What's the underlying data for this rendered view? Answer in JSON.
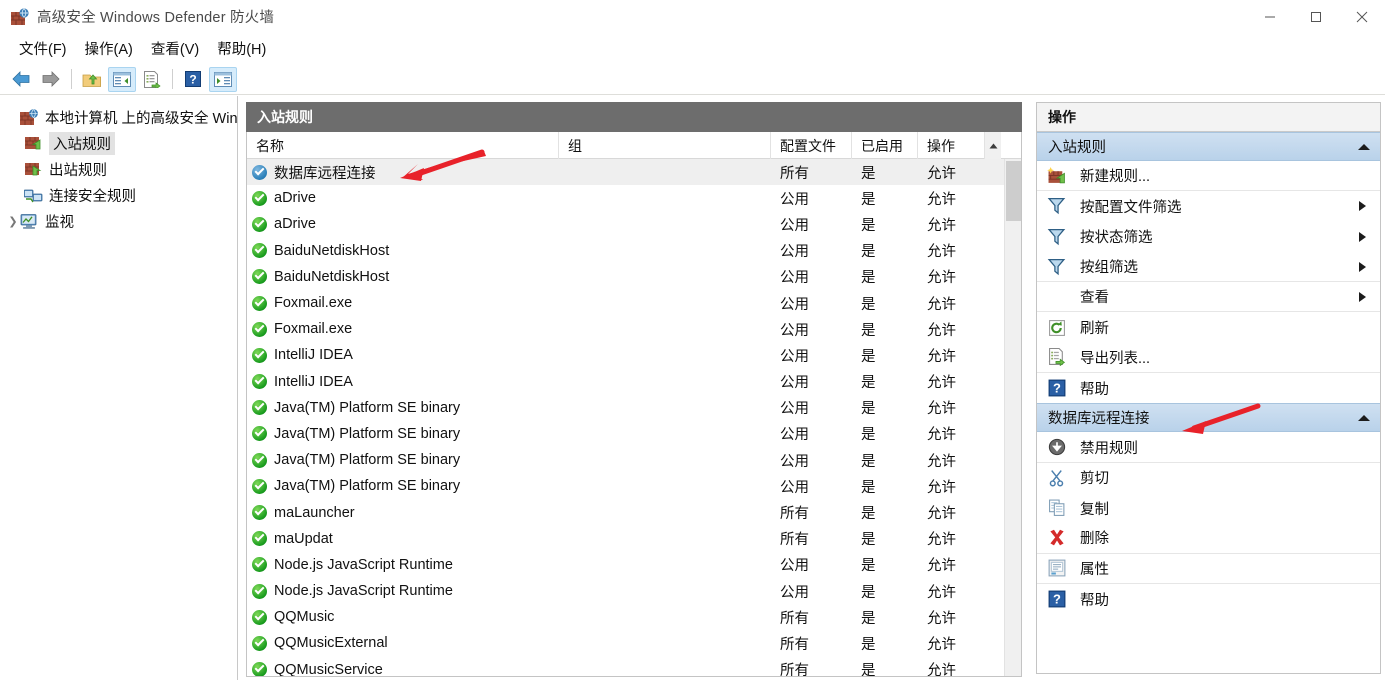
{
  "window": {
    "title": "高级安全 Windows Defender 防火墙",
    "icon": "firewall-brick-icon",
    "minimize_label": "最小化",
    "maximize_label": "最大化",
    "close_label": "关闭"
  },
  "menubar": {
    "items": [
      {
        "label": "文件(F)",
        "name": "menu-file"
      },
      {
        "label": "操作(A)",
        "name": "menu-action"
      },
      {
        "label": "查看(V)",
        "name": "menu-view"
      },
      {
        "label": "帮助(H)",
        "name": "menu-help"
      }
    ]
  },
  "toolbar": {
    "buttons": [
      {
        "name": "back-button",
        "icon": "arrow-left-icon",
        "active": false
      },
      {
        "name": "forward-button",
        "icon": "arrow-right-icon",
        "active": false
      },
      {
        "name": "up-one-level-button",
        "icon": "folder-up-icon",
        "active": false
      },
      {
        "name": "show-hide-console-tree-button",
        "icon": "console-tree-icon",
        "active": true
      },
      {
        "name": "export-list-button",
        "icon": "export-list-icon",
        "active": false
      },
      {
        "name": "help-button",
        "icon": "question-mark-icon",
        "active": false
      },
      {
        "name": "show-hide-action-pane-button",
        "icon": "action-pane-icon",
        "active": true
      }
    ]
  },
  "tree": {
    "root": {
      "label": "本地计算机 上的高级安全 Wind",
      "icon": "firewall-brick-icon"
    },
    "items": [
      {
        "label": "入站规则",
        "icon": "inbound-rules-icon",
        "selected": true,
        "expandable": false
      },
      {
        "label": "出站规则",
        "icon": "outbound-rules-icon",
        "selected": false,
        "expandable": false
      },
      {
        "label": "连接安全规则",
        "icon": "connection-security-icon",
        "selected": false,
        "expandable": false
      },
      {
        "label": "监视",
        "icon": "monitoring-icon",
        "selected": false,
        "expandable": true
      }
    ]
  },
  "center": {
    "title": "入站规则",
    "columns": [
      {
        "key": "name",
        "label": "名称"
      },
      {
        "key": "group",
        "label": "组"
      },
      {
        "key": "profile",
        "label": "配置文件"
      },
      {
        "key": "enabled",
        "label": "已启用"
      },
      {
        "key": "action",
        "label": "操作"
      }
    ],
    "rows": [
      {
        "name": "数据库远程连接",
        "group": "",
        "profile": "所有",
        "enabled": "是",
        "action": "允许",
        "icon": "rule-enabled-selected-icon",
        "selected": true
      },
      {
        "name": "aDrive",
        "group": "",
        "profile": "公用",
        "enabled": "是",
        "action": "允许",
        "icon": "rule-enabled-icon",
        "selected": false
      },
      {
        "name": "aDrive",
        "group": "",
        "profile": "公用",
        "enabled": "是",
        "action": "允许",
        "icon": "rule-enabled-icon",
        "selected": false
      },
      {
        "name": "BaiduNetdiskHost",
        "group": "",
        "profile": "公用",
        "enabled": "是",
        "action": "允许",
        "icon": "rule-enabled-icon",
        "selected": false
      },
      {
        "name": "BaiduNetdiskHost",
        "group": "",
        "profile": "公用",
        "enabled": "是",
        "action": "允许",
        "icon": "rule-enabled-icon",
        "selected": false
      },
      {
        "name": "Foxmail.exe",
        "group": "",
        "profile": "公用",
        "enabled": "是",
        "action": "允许",
        "icon": "rule-enabled-icon",
        "selected": false
      },
      {
        "name": "Foxmail.exe",
        "group": "",
        "profile": "公用",
        "enabled": "是",
        "action": "允许",
        "icon": "rule-enabled-icon",
        "selected": false
      },
      {
        "name": "IntelliJ IDEA",
        "group": "",
        "profile": "公用",
        "enabled": "是",
        "action": "允许",
        "icon": "rule-enabled-icon",
        "selected": false
      },
      {
        "name": "IntelliJ IDEA",
        "group": "",
        "profile": "公用",
        "enabled": "是",
        "action": "允许",
        "icon": "rule-enabled-icon",
        "selected": false
      },
      {
        "name": "Java(TM) Platform SE binary",
        "group": "",
        "profile": "公用",
        "enabled": "是",
        "action": "允许",
        "icon": "rule-enabled-icon",
        "selected": false
      },
      {
        "name": "Java(TM) Platform SE binary",
        "group": "",
        "profile": "公用",
        "enabled": "是",
        "action": "允许",
        "icon": "rule-enabled-icon",
        "selected": false
      },
      {
        "name": "Java(TM) Platform SE binary",
        "group": "",
        "profile": "公用",
        "enabled": "是",
        "action": "允许",
        "icon": "rule-enabled-icon",
        "selected": false
      },
      {
        "name": "Java(TM) Platform SE binary",
        "group": "",
        "profile": "公用",
        "enabled": "是",
        "action": "允许",
        "icon": "rule-enabled-icon",
        "selected": false
      },
      {
        "name": "maLauncher",
        "group": "",
        "profile": "所有",
        "enabled": "是",
        "action": "允许",
        "icon": "rule-enabled-icon",
        "selected": false
      },
      {
        "name": "maUpdat",
        "group": "",
        "profile": "所有",
        "enabled": "是",
        "action": "允许",
        "icon": "rule-enabled-icon",
        "selected": false
      },
      {
        "name": "Node.js JavaScript Runtime",
        "group": "",
        "profile": "公用",
        "enabled": "是",
        "action": "允许",
        "icon": "rule-enabled-icon",
        "selected": false
      },
      {
        "name": "Node.js JavaScript Runtime",
        "group": "",
        "profile": "公用",
        "enabled": "是",
        "action": "允许",
        "icon": "rule-enabled-icon",
        "selected": false
      },
      {
        "name": "QQMusic",
        "group": "",
        "profile": "所有",
        "enabled": "是",
        "action": "允许",
        "icon": "rule-enabled-icon",
        "selected": false
      },
      {
        "name": "QQMusicExternal",
        "group": "",
        "profile": "所有",
        "enabled": "是",
        "action": "允许",
        "icon": "rule-enabled-icon",
        "selected": false
      },
      {
        "name": "QQMusicService",
        "group": "",
        "profile": "所有",
        "enabled": "是",
        "action": "允许",
        "icon": "rule-enabled-icon",
        "selected": false
      }
    ]
  },
  "actions": {
    "title": "操作",
    "groups": [
      {
        "header": "入站规则",
        "name": "actions-group-inbound-rules",
        "items": [
          {
            "label": "新建规则...",
            "icon": "new-rule-icon",
            "submenu": false,
            "separator": true
          },
          {
            "label": "按配置文件筛选",
            "icon": "filter-icon",
            "submenu": true,
            "separator": false
          },
          {
            "label": "按状态筛选",
            "icon": "filter-icon",
            "submenu": true,
            "separator": false
          },
          {
            "label": "按组筛选",
            "icon": "filter-icon",
            "submenu": true,
            "separator": true
          },
          {
            "label": "查看",
            "icon": "none",
            "submenu": true,
            "separator": true
          },
          {
            "label": "刷新",
            "icon": "refresh-icon",
            "submenu": false,
            "separator": false
          },
          {
            "label": "导出列表...",
            "icon": "export-list-icon",
            "submenu": false,
            "separator": true
          },
          {
            "label": "帮助",
            "icon": "question-mark-icon",
            "submenu": false,
            "separator": false
          }
        ]
      },
      {
        "header": "数据库远程连接",
        "name": "actions-group-selected-rule",
        "items": [
          {
            "label": "禁用规则",
            "icon": "disable-rule-icon",
            "submenu": false,
            "separator": true
          },
          {
            "label": "剪切",
            "icon": "cut-icon",
            "submenu": false,
            "separator": false
          },
          {
            "label": "复制",
            "icon": "copy-icon",
            "submenu": false,
            "separator": false
          },
          {
            "label": "删除",
            "icon": "delete-x-icon",
            "submenu": false,
            "separator": true
          },
          {
            "label": "属性",
            "icon": "properties-icon",
            "submenu": false,
            "separator": true
          },
          {
            "label": "帮助",
            "icon": "question-mark-icon",
            "submenu": false,
            "separator": false
          }
        ]
      }
    ]
  },
  "annotations": [
    {
      "name": "red-arrow-rule-row",
      "color": "#e8222a",
      "points_to": "数据库远程连接"
    },
    {
      "name": "red-arrow-actions-group",
      "color": "#e8222a",
      "points_to": "数据库远程连接"
    }
  ],
  "colors": {
    "accent_header": "#6d6d6d",
    "group_header_top": "#cfe0f1",
    "group_header_bottom": "#b9d2ea",
    "annotation_red": "#e8222a",
    "toolbar_active": "#d6ecfb",
    "row_selected": "#efefef"
  }
}
